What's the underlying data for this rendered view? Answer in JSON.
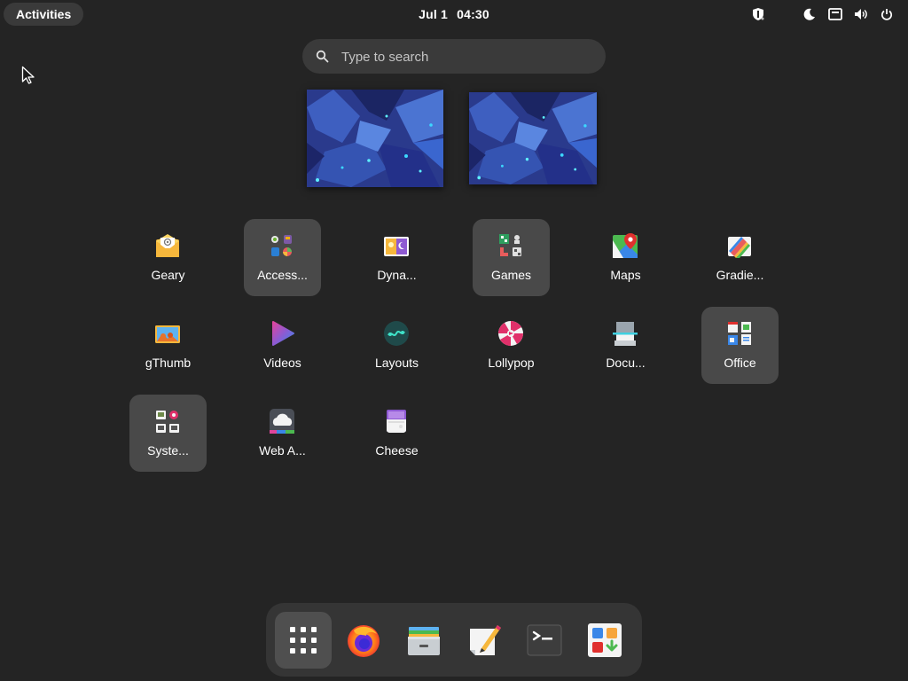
{
  "topbar": {
    "activities_label": "Activities",
    "date": "Jul 1",
    "time": "04:30",
    "indicators": [
      "security-shield-icon",
      "night-light-icon",
      "network-wired-icon",
      "volume-icon",
      "power-icon"
    ]
  },
  "search": {
    "placeholder": "Type to search",
    "value": ""
  },
  "workspaces": [
    {
      "name": "workspace-1"
    },
    {
      "name": "workspace-2"
    }
  ],
  "apps": [
    {
      "label": "Geary",
      "icon": "geary-mail-icon",
      "folder": false
    },
    {
      "label": "Access...",
      "icon": "accessories-folder-icon",
      "folder": true
    },
    {
      "label": "Dyna...",
      "icon": "dynamic-wallpaper-icon",
      "folder": false
    },
    {
      "label": "Games",
      "icon": "games-folder-icon",
      "folder": true
    },
    {
      "label": "Maps",
      "icon": "maps-icon",
      "folder": false
    },
    {
      "label": "Gradie...",
      "icon": "gradience-icon",
      "folder": false
    },
    {
      "label": "gThumb",
      "icon": "gthumb-icon",
      "folder": false
    },
    {
      "label": "Videos",
      "icon": "videos-icon",
      "folder": false
    },
    {
      "label": "Layouts",
      "icon": "layouts-icon",
      "folder": false
    },
    {
      "label": "Lollypop",
      "icon": "lollypop-icon",
      "folder": false
    },
    {
      "label": "Docu...",
      "icon": "document-scanner-icon",
      "folder": false
    },
    {
      "label": "Office",
      "icon": "office-folder-icon",
      "folder": true
    },
    {
      "label": "Syste...",
      "icon": "system-folder-icon",
      "folder": true
    },
    {
      "label": "Web A...",
      "icon": "web-apps-icon",
      "folder": false
    },
    {
      "label": "Cheese",
      "icon": "cheese-icon",
      "folder": false
    }
  ],
  "dash": [
    {
      "name": "show-apps-grid-icon",
      "active": true
    },
    {
      "name": "firefox-icon",
      "active": false
    },
    {
      "name": "files-icon",
      "active": false
    },
    {
      "name": "text-editor-icon",
      "active": false
    },
    {
      "name": "terminal-icon",
      "active": false
    },
    {
      "name": "software-icon",
      "active": false
    }
  ]
}
